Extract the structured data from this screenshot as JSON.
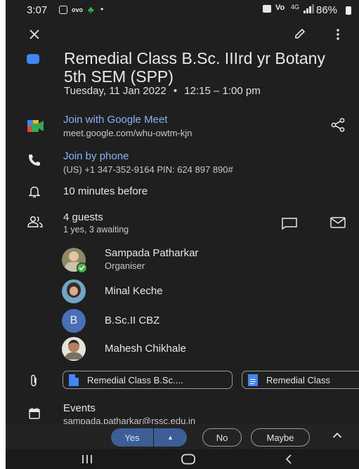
{
  "status_bar": {
    "time": "3:07",
    "network": "Vo",
    "signal_text": "4G",
    "battery": "86%"
  },
  "event": {
    "title": "Remedial Class B.Sc. IIIrd yr Botany 5th SEM (SPP)",
    "date": "Tuesday, 11 Jan 2022",
    "separator": "•",
    "time": "12:15 – 1:00 pm",
    "color": "#4285f4"
  },
  "meet": {
    "label": "Join with Google Meet",
    "url": "meet.google.com/whu-owtm-kjn"
  },
  "phone": {
    "label": "Join by phone",
    "details": "(US) +1 347-352-9164 PIN: 624 897 890#"
  },
  "reminder": "10 minutes before",
  "guests": {
    "count": "4 guests",
    "status": "1 yes, 3 awaiting",
    "list": [
      {
        "name": "Sampada Patharkar",
        "role": "Organiser"
      },
      {
        "name": "Minal Keche",
        "role": ""
      },
      {
        "name": "B.Sc.II CBZ",
        "role": "",
        "initial": "B"
      },
      {
        "name": "Mahesh Chikhale",
        "role": ""
      }
    ]
  },
  "attachments": [
    {
      "label": "Remedial Class B.Sc...."
    },
    {
      "label": "Remedial Class"
    }
  ],
  "calendar": {
    "name": "Events",
    "owner": "sampada.patharkar@rssc.edu.in"
  },
  "rsvp": {
    "yes": "Yes",
    "no": "No",
    "maybe": "Maybe"
  },
  "colors": {
    "background": "#1f1f1f",
    "accent": "#8ab4f8",
    "yes_button": "#3d5d95",
    "verified": "#4caf50"
  },
  "icons": [
    "close-icon",
    "edit-icon",
    "more-vert-icon",
    "video-icon",
    "share-icon",
    "phone-icon",
    "bell-icon",
    "people-icon",
    "chat-icon",
    "mail-icon",
    "attachment-icon",
    "calendar-icon",
    "expand-icon"
  ]
}
